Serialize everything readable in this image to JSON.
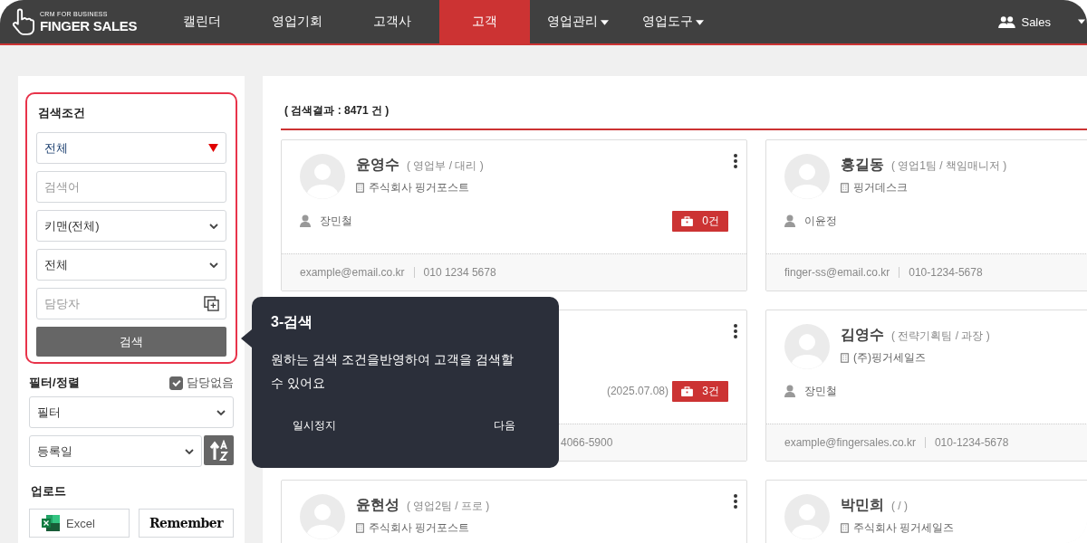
{
  "nav": {
    "logo_tagline": "CRM FOR BUSINESS",
    "logo_name": "FINGER SALES",
    "items": [
      {
        "label": "캘린더",
        "selected": false,
        "dropdown": false
      },
      {
        "label": "영업기회",
        "selected": false,
        "dropdown": false
      },
      {
        "label": "고객사",
        "selected": false,
        "dropdown": false
      },
      {
        "label": "고객",
        "selected": true,
        "dropdown": false
      },
      {
        "label": "영업관리",
        "selected": false,
        "dropdown": true
      },
      {
        "label": "영업도구",
        "selected": false,
        "dropdown": true
      }
    ],
    "user": "Sales"
  },
  "search_panel": {
    "title": "검색조건",
    "fields": [
      {
        "kind": "dropdown",
        "value": "전체"
      },
      {
        "kind": "input",
        "placeholder": "검색어"
      },
      {
        "kind": "select",
        "value": "키맨(전체)"
      },
      {
        "kind": "select",
        "value": "전체"
      },
      {
        "kind": "picker",
        "placeholder": "담당자"
      }
    ],
    "button": "검색"
  },
  "filter": {
    "title": "필터/정렬",
    "unassigned": {
      "label": "담당없음",
      "checked": true
    },
    "filter_select": "필터",
    "sort_select": "등록일"
  },
  "upload": {
    "title": "업로드",
    "buttons": [
      {
        "kind": "excel",
        "label": "Excel"
      },
      {
        "kind": "remember",
        "label": "Remember"
      }
    ]
  },
  "results": {
    "summary": "( 검색결과 : 8471 건 )",
    "cards": [
      {
        "name": "윤영수",
        "position": "( 영업부 / 대리 )",
        "company": "주식회사 핑거포스트",
        "manager": "장민철",
        "count": "0건",
        "email": "example@email.co.kr",
        "phone": "010 1234 5678"
      },
      {
        "name": "홍길동",
        "position": "( 영업1팀 / 책임매니저 )",
        "company": "핑거데스크",
        "manager": "이윤정",
        "email": "finger-ss@email.co.kr",
        "phone": "010-1234-5678"
      },
      {
        "date": "(2025.07.08)",
        "count": "3건",
        "phone": "4066-5900"
      },
      {
        "name": "김영수",
        "position": "( 전략기획팀 / 과장 )",
        "company": "(주)핑거세일즈",
        "manager": "장민철",
        "email": "example@fingersales.co.kr",
        "phone": "010-1234-5678"
      },
      {
        "name": "윤현성",
        "position": "( 영업2팀 / 프로 )",
        "company": "주식회사 핑거포스트"
      },
      {
        "name": "박민희",
        "position": "( / )",
        "company": "주식회사 핑거세일즈"
      }
    ]
  },
  "tour": {
    "title": "3-검색",
    "body": "원하는 검색 조건을반영하여 고객을 검색할 수 있어요",
    "buttons": [
      "일시정지",
      "다음"
    ]
  }
}
